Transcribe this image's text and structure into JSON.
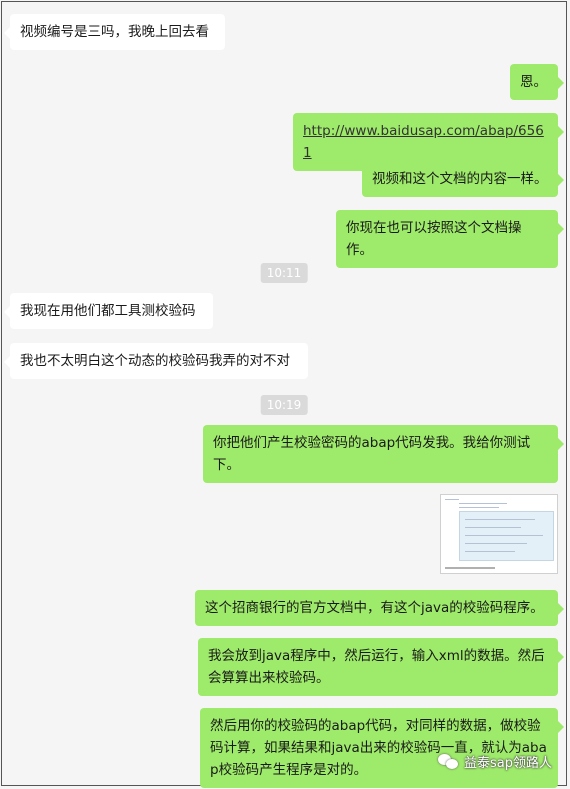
{
  "messages": [
    {
      "side": "left",
      "text": "视频编号是三吗，我晚上回去看"
    },
    {
      "side": "right",
      "text": "恩。"
    },
    {
      "side": "right",
      "link": "http://www.baidusap.com/abap/6561"
    },
    {
      "side": "right",
      "text": "视频和这个文档的内容一样。"
    },
    {
      "side": "right",
      "text": "你现在也可以按照这个文档操作。"
    },
    {
      "side": "left",
      "text": "我现在用他们都工具测校验码"
    },
    {
      "side": "left",
      "text": "我也不太明白这个动态的校验码我弄的对不对"
    },
    {
      "side": "right",
      "text": "你把他们产生校验密码的abap代码发我。我给你测试下。"
    },
    {
      "side": "right",
      "text": "这个招商银行的官方文档中，有这个java的校验码程序。"
    },
    {
      "side": "right",
      "text": "我会放到java程序中，然后运行，输入xml的数据。然后会算算出来校验码。"
    },
    {
      "side": "right",
      "text": "然后用你的校验码的abap代码，对同样的数据，做校验码计算，如果结果和java出来的校验码一直，就认为abap校验码产生程序是对的。"
    }
  ],
  "timestamps": [
    "10:11",
    "10:19"
  ],
  "image_attachment": {
    "icon": "document-screenshot"
  },
  "watermark": {
    "text": "益泰sap领路人",
    "icon": "wechat-icon"
  }
}
